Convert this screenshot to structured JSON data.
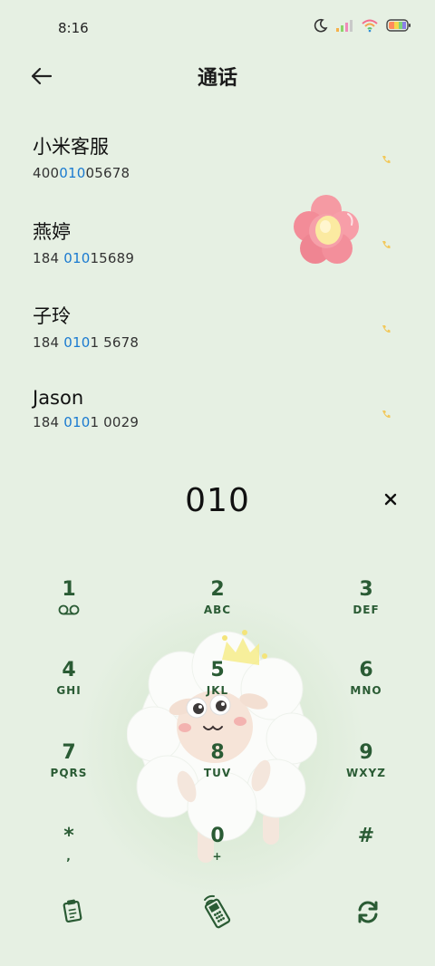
{
  "status": {
    "time": "8:16"
  },
  "header": {
    "title": "通话"
  },
  "contacts": [
    {
      "name": "小米客服",
      "num_pre": "400",
      "num_hl": "010",
      "num_post": "05678"
    },
    {
      "name": "燕婷",
      "num_pre": "184 ",
      "num_hl": "010",
      "num_post": "15689"
    },
    {
      "name": "子玲",
      "num_pre": "184 ",
      "num_hl": "010",
      "num_post": "1 5678"
    },
    {
      "name": "Jason",
      "num_pre": "184 ",
      "num_hl": "010",
      "num_post": "1 0029"
    }
  ],
  "input": {
    "number": "010",
    "clear_label": "×"
  },
  "keypad": [
    {
      "digit": "1",
      "letters": ""
    },
    {
      "digit": "2",
      "letters": "ABC"
    },
    {
      "digit": "3",
      "letters": "DEF"
    },
    {
      "digit": "4",
      "letters": "GHI"
    },
    {
      "digit": "5",
      "letters": "JKL"
    },
    {
      "digit": "6",
      "letters": "MNO"
    },
    {
      "digit": "7",
      "letters": "PQRS"
    },
    {
      "digit": "8",
      "letters": "TUV"
    },
    {
      "digit": "9",
      "letters": "WXYZ"
    },
    {
      "digit": "*",
      "letters": ","
    },
    {
      "digit": "0",
      "letters": "+"
    },
    {
      "digit": "#",
      "letters": ""
    }
  ],
  "icons": {
    "voicemail": "voicemail-icon",
    "call": "call-icon",
    "back": "back-arrow-icon"
  },
  "colors": {
    "background": "#e6f0e3",
    "highlight": "#1a7ad0",
    "keypad": "#2a5b34"
  }
}
